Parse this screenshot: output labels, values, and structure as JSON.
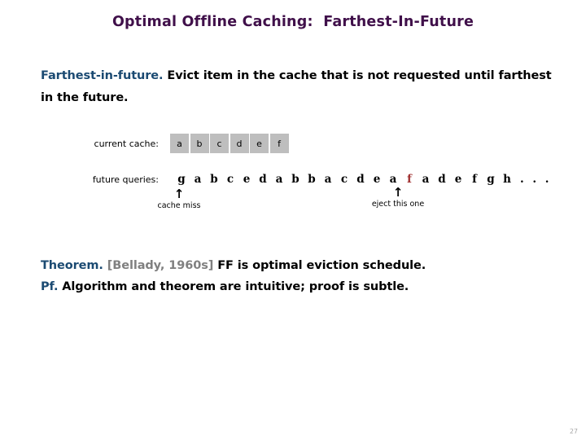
{
  "slide": {
    "title": "Optimal Offline Caching:  Farthest-In-Future",
    "page_number": "27",
    "colors": {
      "title": "#40104a",
      "accent_blue": "#1b4a72",
      "cite_gray": "#808080",
      "highlight_red": "#a03030",
      "cache_cell_bg": "#bebebe",
      "page_number": "#a8a8a8"
    }
  },
  "lead": {
    "term": "Farthest-in-future.",
    "text": "  Evict item in the cache that is not requested until farthest in the future."
  },
  "diagram": {
    "cache_label": "current cache:",
    "cache_cells": [
      "a",
      "b",
      "c",
      "d",
      "e",
      "f"
    ],
    "queries_label": "future queries:",
    "queries": [
      {
        "letter": "g",
        "highlight": false
      },
      {
        "letter": "a",
        "highlight": false
      },
      {
        "letter": "b",
        "highlight": false
      },
      {
        "letter": "c",
        "highlight": false
      },
      {
        "letter": "e",
        "highlight": false
      },
      {
        "letter": "d",
        "highlight": false
      },
      {
        "letter": "a",
        "highlight": false
      },
      {
        "letter": "b",
        "highlight": false
      },
      {
        "letter": "b",
        "highlight": false
      },
      {
        "letter": "a",
        "highlight": false
      },
      {
        "letter": "c",
        "highlight": false
      },
      {
        "letter": "d",
        "highlight": false
      },
      {
        "letter": "e",
        "highlight": false
      },
      {
        "letter": "a",
        "highlight": false
      },
      {
        "letter": "f",
        "highlight": true
      },
      {
        "letter": "a",
        "highlight": false
      },
      {
        "letter": "d",
        "highlight": false
      },
      {
        "letter": "e",
        "highlight": false
      },
      {
        "letter": "f",
        "highlight": false
      },
      {
        "letter": "g",
        "highlight": false
      },
      {
        "letter": "h",
        "highlight": false
      }
    ],
    "ellipsis": ". . .",
    "annotations": {
      "left": {
        "arrow": "↑",
        "caption": "cache miss"
      },
      "right": {
        "arrow": "↑",
        "caption": "eject this one"
      }
    }
  },
  "theorem": {
    "label": "Theorem.",
    "citation": "  [Bellady, 1960s]",
    "statement": "  FF is optimal eviction schedule.",
    "proof_label": "Pf.",
    "proof_text": "  Algorithm and theorem are intuitive; proof is subtle."
  }
}
